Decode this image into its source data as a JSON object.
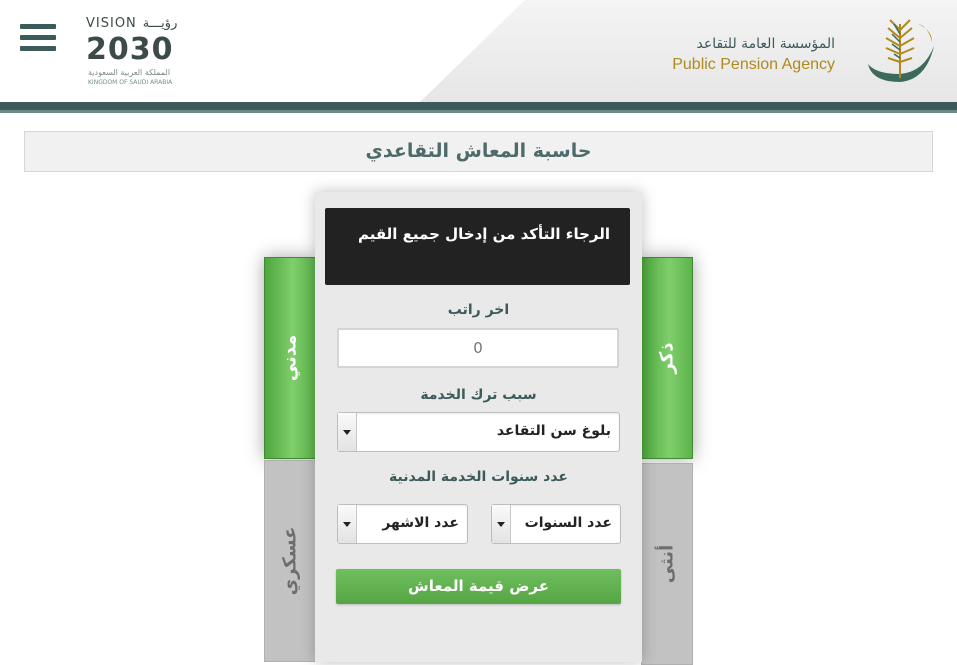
{
  "header": {
    "menu_icon": "hamburger-menu-icon",
    "vision": {
      "top_en": "VISION",
      "top_ar": "رؤيـــة",
      "year": "2030",
      "kingdom_ar": "المملكة العربية السعودية",
      "kingdom_en": "KINGDOM OF SAUDI ARABIA"
    },
    "agency": {
      "name_ar": "المؤسسة العامة للتقاعد",
      "name_en": "Public Pension Agency",
      "logo": "palm-leaf-logo"
    },
    "colors": {
      "dark_teal": "#3d5a5a",
      "gold": "#b08a1e"
    }
  },
  "page": {
    "title": "حاسبة المعاش التقاعدي"
  },
  "tabs": {
    "male": "ذكر",
    "female": "أنثى",
    "civil": "مدني",
    "military": "عسكري",
    "active_color": "#5db34b",
    "inactive_color": "#c2c2c2"
  },
  "calculator": {
    "alert": "الرجاء التأكد من إدخال جميع القيم",
    "salary_label": "اخر راتب",
    "salary_placeholder": "0",
    "reason_label": "سبب ترك الخدمة",
    "reason_value": "بلوغ سن التقاعد",
    "years_label": "عدد سنوات الخدمة المدنية",
    "years_select": "عدد السنوات",
    "months_select": "عدد الاشهر",
    "submit_label": "عرض قيمة المعاش",
    "button_color": "#5db34b"
  }
}
